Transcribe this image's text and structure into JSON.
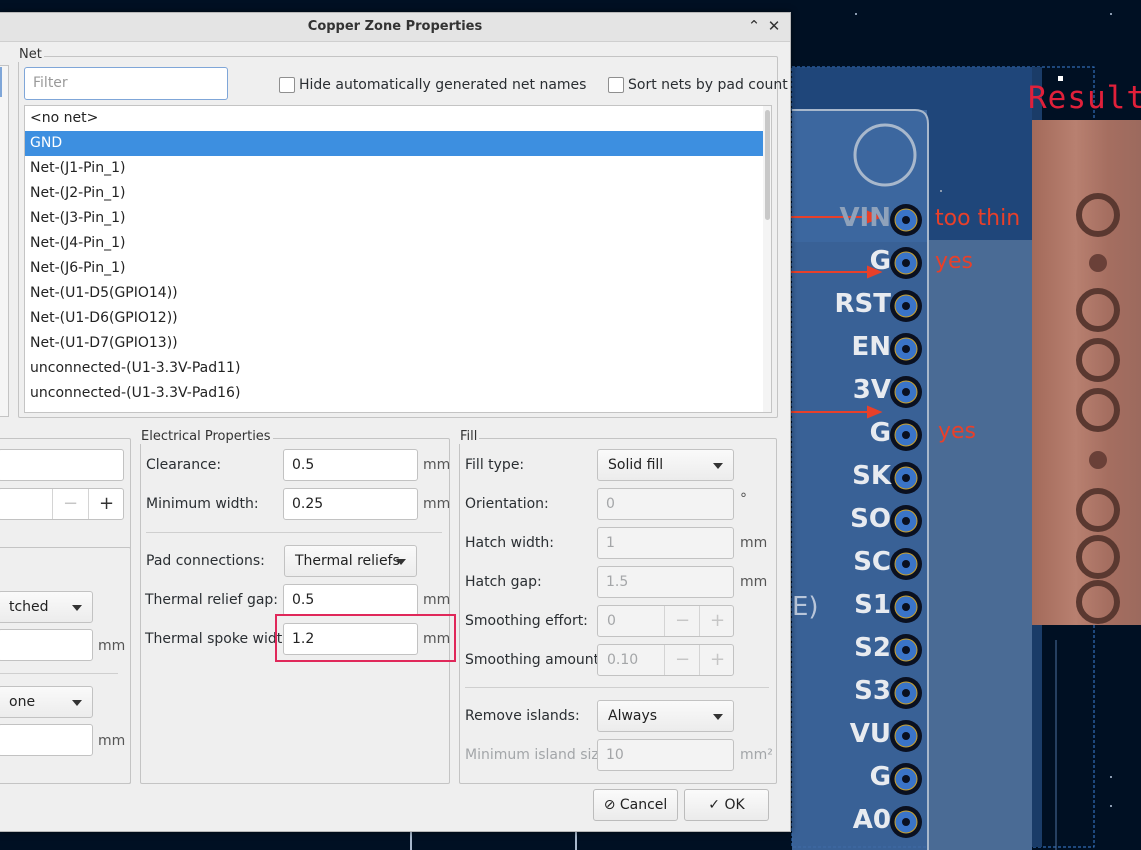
{
  "dialog": {
    "title": "Copper Zone Properties",
    "net": {
      "group_title": "Net",
      "filter_placeholder": "Filter",
      "hide_auto_label": "Hide automatically generated net names",
      "sort_label": "Sort nets by pad count",
      "items": [
        "<no net>",
        "GND",
        "Net-(J1-Pin_1)",
        "Net-(J2-Pin_1)",
        "Net-(J3-Pin_1)",
        "Net-(J4-Pin_1)",
        "Net-(J6-Pin_1)",
        "Net-(U1-D5(GPIO14))",
        "Net-(U1-D6(GPIO12))",
        "Net-(U1-D7(GPIO13))",
        "unconnected-(U1-3.3V-Pad11)",
        "unconnected-(U1-3.3V-Pad16)"
      ],
      "selected_index": 1
    },
    "left_partial": {
      "combo1": "tched",
      "unit1": "mm",
      "combo2": "one",
      "unit2": "mm",
      "spin_minus": "−",
      "spin_plus": "+"
    },
    "electrical": {
      "group_title": "Electrical Properties",
      "clearance_label": "Clearance:",
      "clearance_value": "0.5",
      "min_width_label": "Minimum width:",
      "min_width_value": "0.25",
      "pad_conn_label": "Pad connections:",
      "pad_conn_value": "Thermal reliefs",
      "relief_gap_label": "Thermal relief gap:",
      "relief_gap_value": "0.5",
      "spoke_width_label": "Thermal spoke width:",
      "spoke_width_value": "1.2",
      "unit": "mm"
    },
    "fill": {
      "group_title": "Fill",
      "type_label": "Fill type:",
      "type_value": "Solid fill",
      "orientation_label": "Orientation:",
      "orientation_value": "0",
      "orientation_unit": "°",
      "hatch_width_label": "Hatch width:",
      "hatch_width_value": "1",
      "hatch_gap_label": "Hatch gap:",
      "hatch_gap_value": "1.5",
      "smoothing_effort_label": "Smoothing effort:",
      "smoothing_effort_value": "0",
      "smoothing_amount_label": "Smoothing amount:",
      "smoothing_amount_value": "0.10",
      "remove_islands_label": "Remove islands:",
      "remove_islands_value": "Always",
      "min_island_label": "Minimum island size:",
      "min_island_value": "10",
      "min_island_unit": "mm²",
      "unit": "mm"
    },
    "buttons": {
      "cancel": "Cancel",
      "ok": "OK"
    }
  },
  "pcb": {
    "result_label": "Result",
    "annotations": [
      "too thin",
      "yes",
      "yes"
    ],
    "pins": [
      "VIN",
      "G",
      "RST",
      "EN",
      "3V",
      "G",
      "SK",
      "SO",
      "SC",
      "S1",
      "S2",
      "S3",
      "VU",
      "G",
      "A0"
    ],
    "partial_text": "E)"
  },
  "colors": {
    "selection": "#3d8fe0",
    "highlight": "#e0285a",
    "annotation": "#e8402a",
    "board": "#001023"
  }
}
